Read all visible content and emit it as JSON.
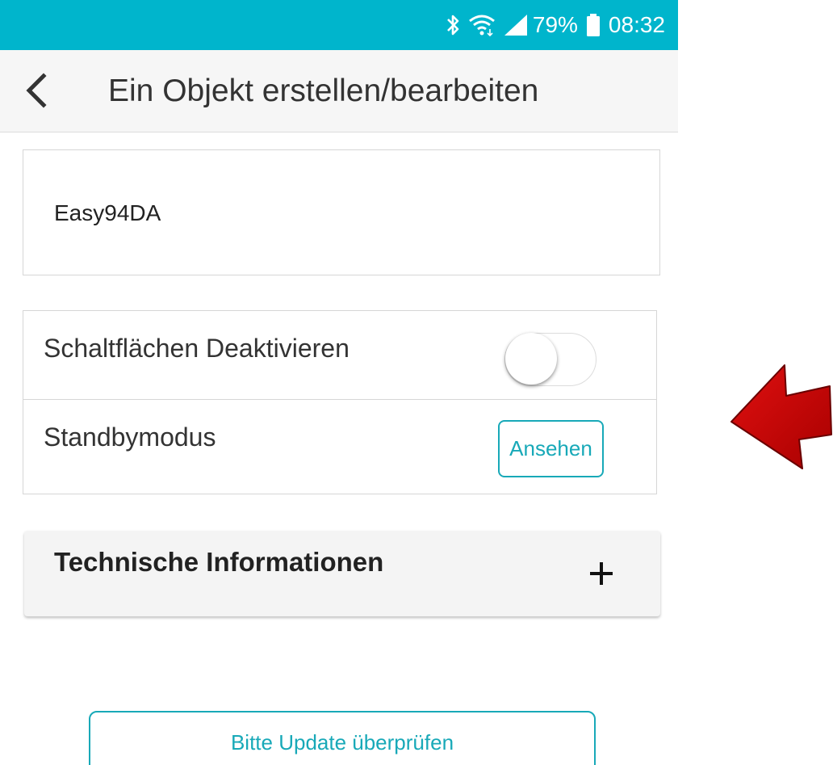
{
  "status_bar": {
    "battery_percent": "79%",
    "time": "08:32",
    "icons": [
      "bluetooth-icon",
      "wifi-icon",
      "signal-icon",
      "battery-icon"
    ],
    "background": "#00b5cc"
  },
  "app_bar": {
    "title": "Ein Objekt erstellen/bearbeiten",
    "back_icon": "chevron-left-icon"
  },
  "name_field": {
    "value": "Easy94DA"
  },
  "settings": {
    "disable_buttons_label": "Schaltflächen Deaktivieren",
    "disable_buttons_enabled": false,
    "standby_label": "Standbymodus",
    "standby_button_label": "Ansehen"
  },
  "technical_info": {
    "title": "Technische Informationen",
    "expand_icon": "plus-icon",
    "expanded": false
  },
  "update_button_label": "Bitte Update überprüfen",
  "annotation": {
    "icon": "red-arrow-icon",
    "color": "#cc0000"
  },
  "colors": {
    "accent": "#18a9b8",
    "card_border": "#d6d6d6",
    "accordion_bg": "#f4f4f4"
  }
}
